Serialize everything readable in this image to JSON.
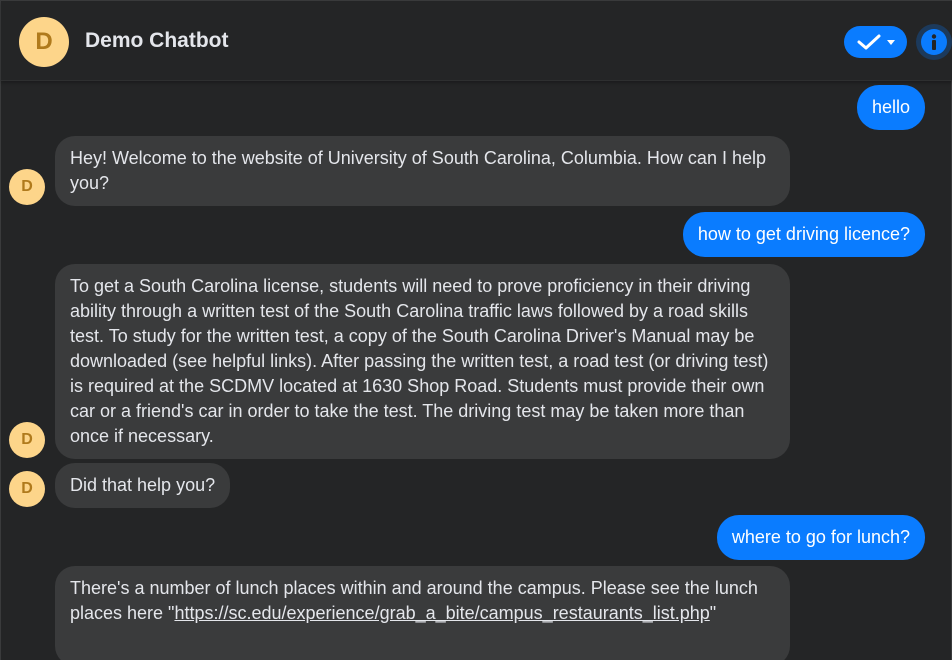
{
  "colors": {
    "background": "#242526",
    "user_bubble": "#0a7cff",
    "bot_bubble": "#3a3b3c",
    "avatar": "#fdd58a",
    "avatar_letter": "#b07a1c"
  },
  "header": {
    "avatar_letter": "D",
    "title": "Demo Chatbot",
    "status_icon": "check-icon",
    "info_icon": "info-icon"
  },
  "messages": [
    {
      "sender": "user",
      "text": "hello"
    },
    {
      "sender": "bot",
      "avatar": "D",
      "text": "Hey! Welcome to the website of University of South Carolina, Columbia. How can I help you?"
    },
    {
      "sender": "user",
      "text": "how to get driving licence?"
    },
    {
      "sender": "bot",
      "avatar": "D",
      "text": "To get a South Carolina license, students will need to prove proficiency in their driving ability through a written test of the South Carolina traffic laws followed by a road skills test. To study for the written test, a copy of the South Carolina Driver's Manual may be downloaded (see helpful links). After passing the written test, a road test (or driving test) is required at the SCDMV located at 1630 Shop Road. Students must provide their own car or a friend's car in order to take the test. The driving test may be taken more than once if necessary."
    },
    {
      "sender": "bot",
      "avatar": "D",
      "text": "Did that help you?"
    },
    {
      "sender": "user",
      "text": "where to go for lunch?"
    },
    {
      "sender": "bot",
      "text_before": "There's a number of lunch places within and around the campus. Please see the lunch places here \"",
      "link": "https://sc.edu/experience/grab_a_bite/campus_restaurants_list.php",
      "text_after": "\""
    }
  ]
}
